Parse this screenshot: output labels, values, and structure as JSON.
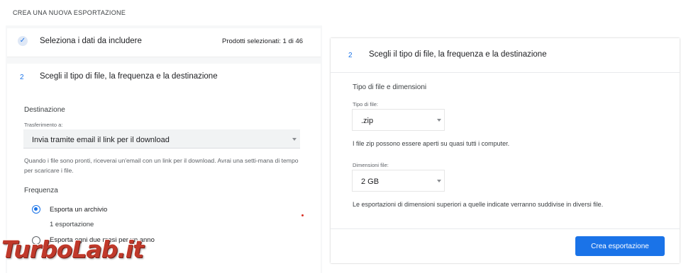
{
  "header": {
    "title": "CREA UNA NUOVA ESPORTAZIONE"
  },
  "step1": {
    "title": "Seleziona i dati da includere",
    "count": "Prodotti selezionati: 1 di 46"
  },
  "step2": {
    "number": "2",
    "title": "Scegli il tipo di file, la frequenza e la destinazione"
  },
  "destination": {
    "heading": "Destinazione",
    "transfer_label": "Trasferimento a:",
    "transfer_value": "Invia tramite email il link per il download",
    "help": "Quando i file sono pronti, riceverai un'email con un link per il download. Avrai una setti-mana di tempo per scaricare i file."
  },
  "frequency": {
    "heading": "Frequenza",
    "options": [
      {
        "label": "Esporta un archivio",
        "sublabel": "1 esportazione",
        "selected": true
      },
      {
        "label": "Esporta ogni due mesi per un anno",
        "selected": false
      }
    ]
  },
  "right_panel": {
    "step_number": "2",
    "title": "Scegli il tipo di file, la frequenza e la destinazione",
    "file_section_heading": "Tipo di file e dimensioni",
    "file_type_label": "Tipo di file:",
    "file_type_value": ".zip",
    "file_type_help": "I file zip possono essere aperti su quasi tutti i computer.",
    "size_label": "Dimensioni file:",
    "size_value": "2 GB",
    "size_help": "Le esportazioni di dimensioni superiori a quelle indicate verranno suddivise in diversi file.",
    "create_button": "Crea esportazione"
  },
  "watermark": {
    "text": "TurboLab.it"
  },
  "colors": {
    "accent": "#1a73e8",
    "watermark": "#c0392b"
  },
  "icons": {
    "step1": "check-icon",
    "dropdown": "caret-down-icon"
  }
}
